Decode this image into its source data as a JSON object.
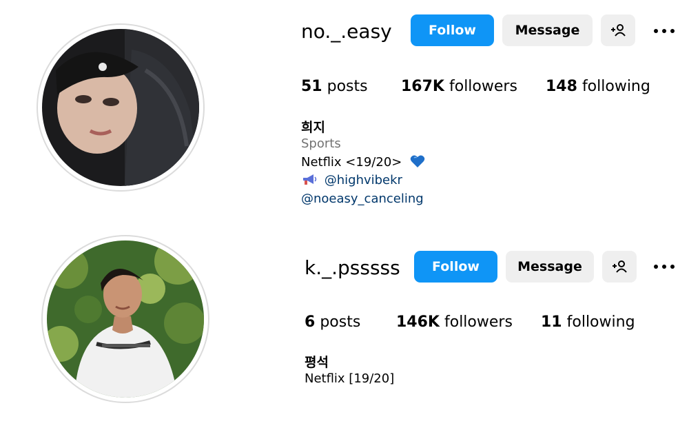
{
  "profiles": [
    {
      "username": "no._.easy",
      "follow_label": "Follow",
      "message_label": "Message",
      "add_user_icon": "person-plus-icon",
      "more_icon": "more-dots-icon",
      "posts_count": "51",
      "posts_label": "posts",
      "followers_count": "167K",
      "followers_label": "followers",
      "following_count": "148",
      "following_label": "following",
      "full_name": "희지",
      "category": "Sports",
      "bio_line1": "Netflix <19/20>",
      "bio_emoji": "blue-heart-icon",
      "megaphone_icon": "megaphone-icon",
      "bio_link1": "@highvibekr",
      "bio_link2": "@noeasy_canceling"
    },
    {
      "username": "k._.psssss",
      "follow_label": "Follow",
      "message_label": "Message",
      "add_user_icon": "person-plus-icon",
      "more_icon": "more-dots-icon",
      "posts_count": "6",
      "posts_label": "posts",
      "followers_count": "146K",
      "followers_label": "followers",
      "following_count": "11",
      "following_label": "following",
      "full_name": "평석",
      "bio_line1": "Netflix [19/20]"
    }
  ],
  "colors": {
    "follow_button": "#0f95f6",
    "secondary_button": "#efefef",
    "category_text": "#737373",
    "link_text": "#00376b",
    "avatar_ring": "#dbdbdb"
  }
}
